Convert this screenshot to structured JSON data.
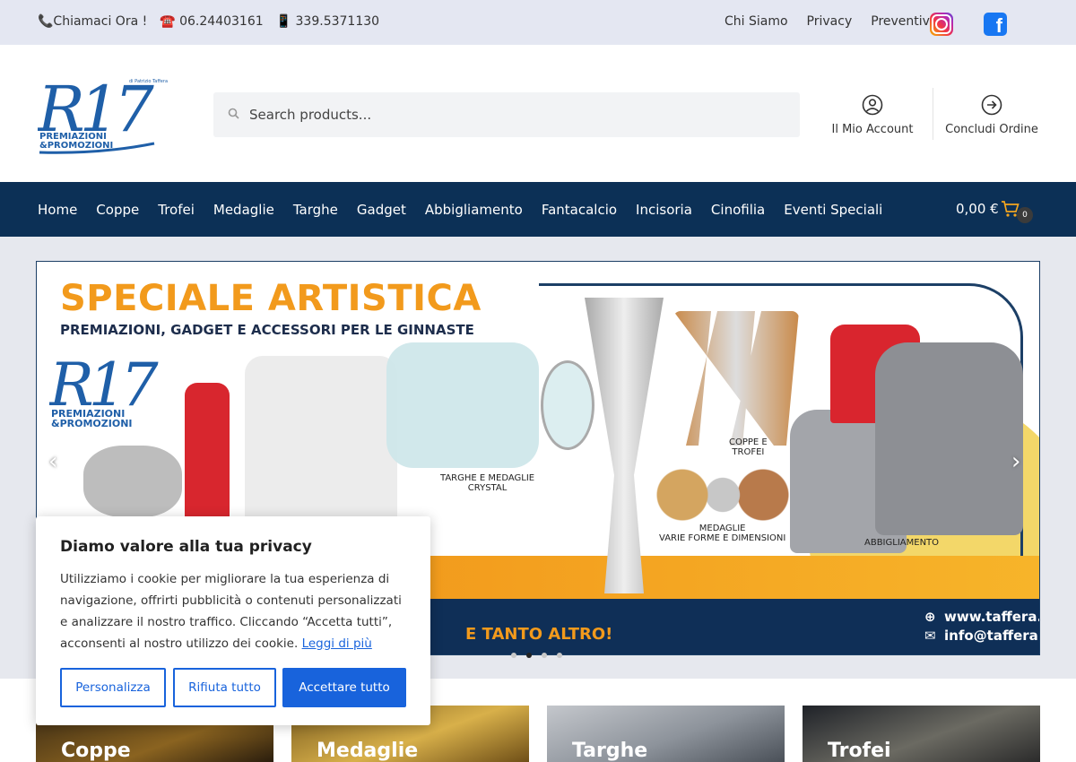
{
  "topbar": {
    "call_label": "📞Chiamaci Ora !",
    "phone": "☎️ 06.24403161",
    "mobile": "📱 339.5371130",
    "links": [
      "Chi Siamo",
      "Privacy",
      "Preventivi"
    ]
  },
  "header": {
    "logo_text": "R17",
    "logo_sub1": "PREMIAZIONI",
    "logo_sub2": "&PROMOZIONI",
    "logo_tag": "di Patrizio Taffera",
    "search_placeholder": "Search products...",
    "account_label": "Il Mio Account",
    "checkout_label": "Concludi Ordine"
  },
  "nav": {
    "items": [
      "Home",
      "Coppe",
      "Trofei",
      "Medaglie",
      "Targhe",
      "Gadget",
      "Abbigliamento",
      "Fantacalcio",
      "Incisoria",
      "Cinofilia",
      "Eventi Speciali"
    ],
    "cart_total": "0,00 €",
    "cart_count": "0"
  },
  "banner": {
    "title": "SPECIALE ARTISTICA",
    "subtitle": "PREMIAZIONI, GADGET E ACCESSORI PER LE GINNASTE",
    "label_targhe": "TARGHE E MEDAGLIE\nCRYSTAL",
    "label_coppe": "COPPE E\nTROFEI",
    "label_medaglie": "MEDAGLIE\nVARIE FORME E DIMENSIONI",
    "label_abbigliamento": "ABBIGLIAMENTO",
    "tagline": "E TANTO ALTRO!",
    "website": "www.taffera.it",
    "email": "info@taffera.it",
    "slides": 4,
    "active_slide": 2
  },
  "categories": [
    "Coppe",
    "Medaglie",
    "Targhe",
    "Trofei"
  ],
  "cookie": {
    "title": "Diamo valore alla tua privacy",
    "text": "Utilizziamo i cookie per migliorare la tua esperienza di navigazione, offrirti pubblicità o contenuti personalizzati e analizzare il nostro traffico. Cliccando “Accetta tutti”, acconsenti al nostro utilizzo dei cookie.",
    "link": "Leggi di più",
    "btn_customize": "Personalizza",
    "btn_reject": "Rifiuta tutto",
    "btn_accept": "Accettare tutto"
  },
  "colors": {
    "nav_bg": "#0c3056",
    "accent": "#1863dc",
    "banner_orange": "#f29a1c"
  },
  "icons": [
    "instagram-icon",
    "facebook-icon",
    "search-icon",
    "user-icon",
    "arrow-right-circle-icon",
    "cart-icon",
    "chevron-left-icon",
    "chevron-right-icon",
    "globe-icon",
    "mail-icon"
  ]
}
